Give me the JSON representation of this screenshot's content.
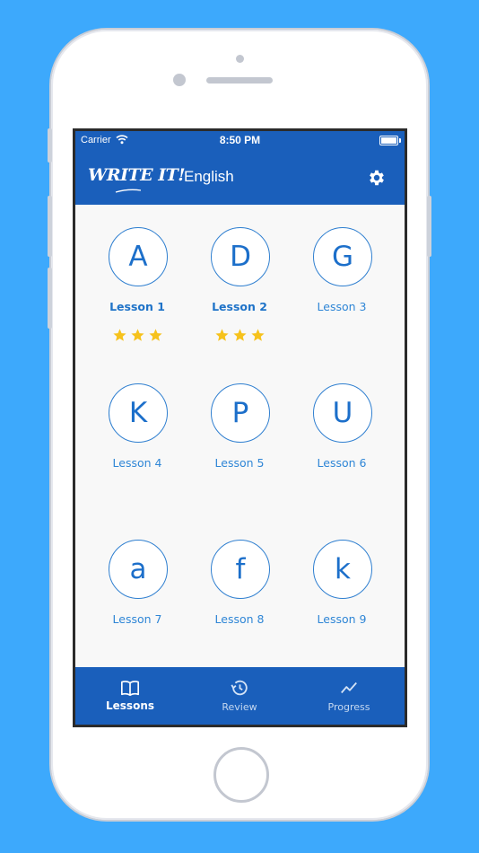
{
  "status_bar": {
    "carrier": "Carrier",
    "time": "8:50 PM"
  },
  "header": {
    "logo_text": "WRITE IT!",
    "language": "English",
    "settings_icon": "gear-icon"
  },
  "lessons": [
    {
      "letter": "A",
      "label": "Lesson 1",
      "stars": 3,
      "completed": true
    },
    {
      "letter": "D",
      "label": "Lesson 2",
      "stars": 3,
      "completed": true
    },
    {
      "letter": "G",
      "label": "Lesson 3",
      "stars": 0,
      "completed": false
    },
    {
      "letter": "K",
      "label": "Lesson 4",
      "stars": 0,
      "completed": false
    },
    {
      "letter": "P",
      "label": "Lesson 5",
      "stars": 0,
      "completed": false
    },
    {
      "letter": "U",
      "label": "Lesson 6",
      "stars": 0,
      "completed": false
    },
    {
      "letter": "a",
      "label": "Lesson 7",
      "stars": 0,
      "completed": false
    },
    {
      "letter": "f",
      "label": "Lesson 8",
      "stars": 0,
      "completed": false
    },
    {
      "letter": "k",
      "label": "Lesson 9",
      "stars": 0,
      "completed": false
    }
  ],
  "tabs": [
    {
      "label": "Lessons",
      "icon": "book-icon",
      "active": true
    },
    {
      "label": "Review",
      "icon": "history-icon",
      "active": false
    },
    {
      "label": "Progress",
      "icon": "chart-line-icon",
      "active": false
    }
  ],
  "colors": {
    "background": "#3da9fc",
    "primary": "#1a5fbb",
    "accent": "#1c6fca",
    "star": "#f6c21c"
  }
}
